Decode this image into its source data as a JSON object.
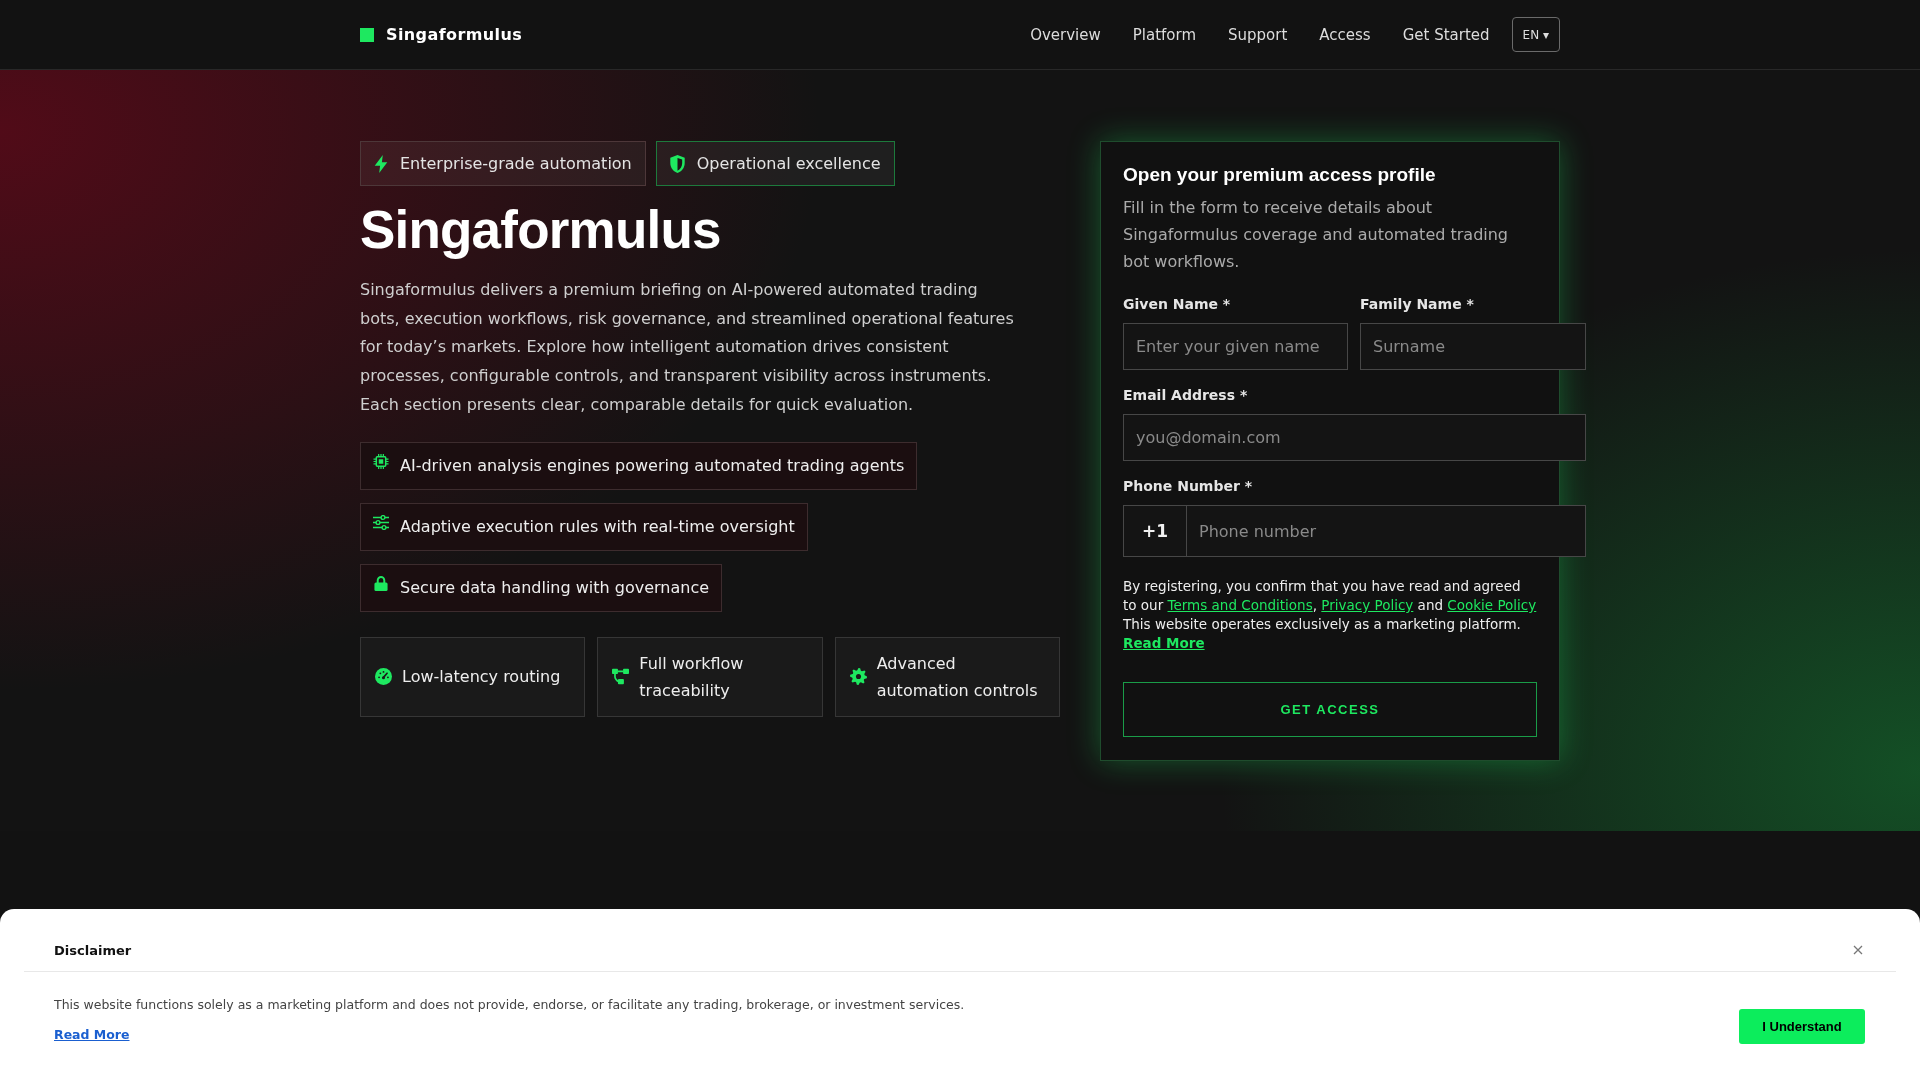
{
  "header": {
    "brand": "Singaformulus",
    "nav": [
      {
        "label": "Overview"
      },
      {
        "label": "Platform"
      },
      {
        "label": "Support"
      },
      {
        "label": "Access"
      },
      {
        "label": "Get Started"
      }
    ],
    "language": "EN ▾"
  },
  "hero": {
    "badges": [
      {
        "label": "Enterprise-grade automation",
        "highlighted": false
      },
      {
        "label": "Operational excellence",
        "highlighted": true
      }
    ],
    "title": "Singaformulus",
    "intro": "Singaformulus delivers a premium briefing on AI-powered automated trading bots, execution workflows, risk governance, and streamlined operational features for today’s markets. Explore how intelligent automation drives consistent processes, configurable controls, and transparent visibility across instruments. Each section presents clear, comparable details for quick evaluation.",
    "highlights": [
      {
        "label": "AI-driven analysis engines powering automated trading agents"
      },
      {
        "label": "Adaptive execution rules with real-time oversight"
      },
      {
        "label": "Secure data handling with governance"
      }
    ],
    "cards": [
      {
        "label": "Low-latency routing"
      },
      {
        "label": "Full workflow traceability"
      },
      {
        "label": "Advanced automation controls"
      }
    ]
  },
  "form": {
    "title": "Open your premium access profile",
    "description": "Fill in the form to receive details about Singaformulus coverage and automated trading bot workflows.",
    "name_fields": [
      {
        "label": "Given Name *",
        "placeholder": "Enter your given name"
      },
      {
        "label": "Family Name *",
        "placeholder": "Surname"
      }
    ],
    "email": {
      "label": "Email Address *",
      "placeholder": "you@domain.com"
    },
    "phone": {
      "label": "Phone Number *",
      "prefix": "+1",
      "placeholder": "Phone number"
    },
    "consent": [
      {
        "kind": "text",
        "text": "By registering, you confirm that you have read and agreed to our "
      },
      {
        "kind": "link",
        "text": "Terms and Conditions"
      },
      {
        "kind": "text",
        "text": ", "
      },
      {
        "kind": "link",
        "text": "Privacy Policy"
      },
      {
        "kind": "text",
        "text": " and "
      },
      {
        "kind": "link",
        "text": "Cookie Policy"
      },
      {
        "kind": "text",
        "text": " This website operates exclusively as a marketing platform. "
      },
      {
        "kind": "strong_link",
        "text": "Read More"
      }
    ],
    "submit": "GET ACCESS"
  },
  "disclaimer": {
    "title": "Disclaimer",
    "text": "This website functions solely as a marketing platform and does not provide, endorse, or facilitate any trading, brokerage, or investment services.",
    "link": "Read More",
    "button": "I Understand"
  }
}
